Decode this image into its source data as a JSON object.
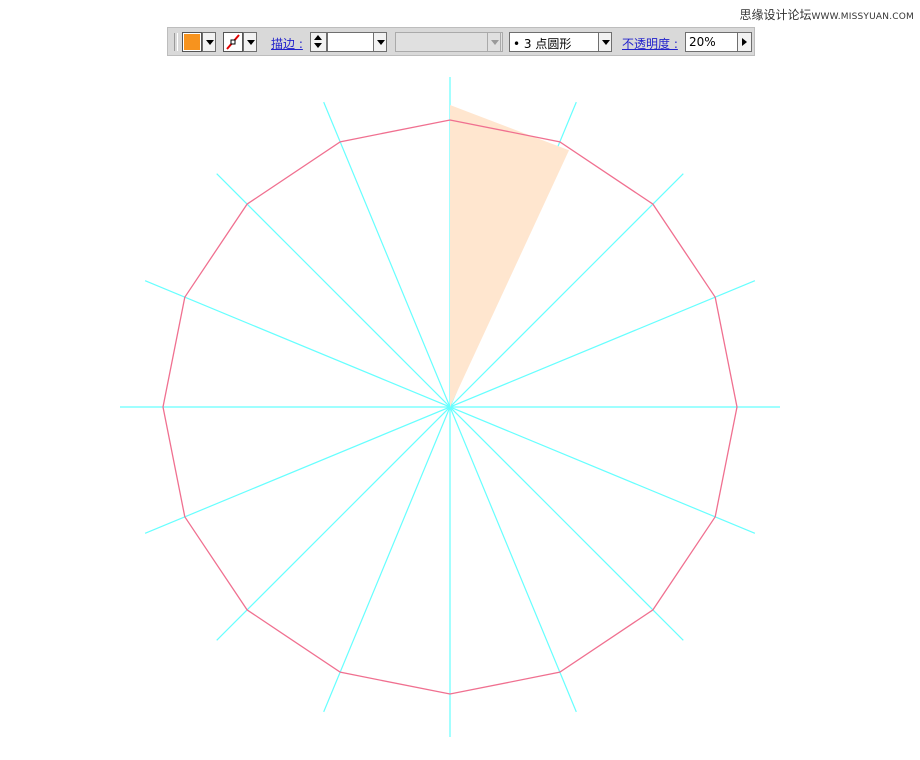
{
  "watermark": {
    "cn": "思缘设计论坛",
    "site": "WWW.MISSYUAN.COM"
  },
  "toolbar": {
    "fill_color": "#f7931e",
    "stroke_label": "描边 :",
    "stroke_weight": "",
    "style_value": "",
    "brush_value": "•  3  点圆形",
    "opacity_label": "不透明度 :",
    "opacity_value": "20%"
  },
  "canvas": {
    "polygon_sides": 16,
    "polygon_stroke": "#f07090",
    "guide_color": "#66ffff",
    "wedge_fill": "#ffe6cf"
  }
}
